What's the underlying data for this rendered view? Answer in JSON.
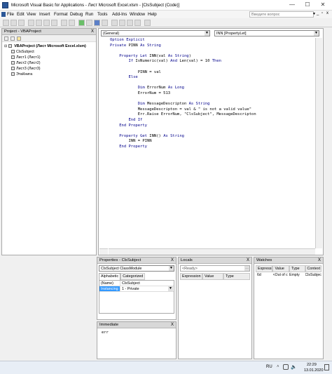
{
  "window": {
    "title": "Microsoft Visual Basic for Applications - Лист Microsoft Excel.xlsm - [ClsSubject (Code)]",
    "min_label": "—",
    "max_label": "☐",
    "close_label": "✕"
  },
  "menu": {
    "items": [
      "File",
      "Edit",
      "View",
      "Insert",
      "Format",
      "Debug",
      "Run",
      "Tools",
      "Add-Ins",
      "Window",
      "Help"
    ],
    "search_placeholder": "Введите вопрос",
    "search_arrow": "▼",
    "doc_controls": [
      "_",
      "▫",
      "x"
    ]
  },
  "project": {
    "header": "Project - VBAProject",
    "close": "X",
    "root": "VBAProject (Лист Microsoft Excel.xlsm)",
    "items": [
      "ClsSubject",
      "Лист1 (Лист1)",
      "Лист2 (Лист2)",
      "Лист3 (Лист3)",
      "ЭтаКнига"
    ]
  },
  "code": {
    "object_combo": "(General)",
    "proc_combo": "INN [PropertyLet]",
    "lines": [
      "Option Explicit",
      "Private PINN As String",
      "",
      "    Property Let INN(val As String)",
      "        If IsNumeric(val) And Len(val) = 10 Then",
      "",
      "            PINN = val",
      "        Else",
      "",
      "            Dim ErrorNum As Long",
      "            ErrorNum = 513",
      "",
      "            Dim MessageDescripton As String",
      "            MessageDescripton = val & \" is not a valid value\"",
      "            Err.Raise ErrorNum, \"ClsSubject\", MessageDescripton",
      "        End If",
      "    End Property",
      "",
      "    Property Get INN() As String",
      "        INN = PINN",
      "    End Property"
    ]
  },
  "properties": {
    "header": "Properties - ClsSubject",
    "close": "X",
    "object_combo": "ClsSubject ClassModule",
    "tabs": [
      "Alphabetic",
      "Categorized"
    ],
    "rows": [
      {
        "name": "(Name)",
        "value": "ClsSubject"
      },
      {
        "name": "Instancing",
        "value": "1 - Private"
      }
    ]
  },
  "immediate": {
    "header": "Immediate",
    "close": "X",
    "text": "err"
  },
  "locals": {
    "header": "Locals",
    "close": "X",
    "ready": "<Ready>",
    "columns": [
      "Expression",
      "Value",
      "Type"
    ]
  },
  "watches": {
    "header": "Watches",
    "close": "X",
    "columns": [
      "Expression",
      "Value",
      "Type",
      "Context"
    ],
    "rows": [
      {
        "expression": "6d",
        "value": "<Out of c",
        "type": "Empty",
        "context": "ClsSubject"
      }
    ]
  },
  "taskbar": {
    "lang": "RU",
    "time": "22:29",
    "date": "13.01.2020"
  }
}
